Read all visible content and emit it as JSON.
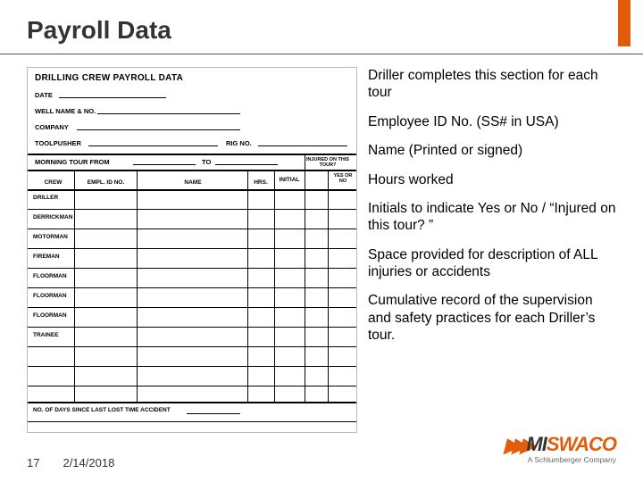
{
  "title": "Payroll Data",
  "form": {
    "header": "DRILLING CREW PAYROLL DATA",
    "fields": {
      "date": "DATE",
      "well": "WELL NAME & NO.",
      "company": "COMPANY",
      "toolpusher": "TOOLPUSHER",
      "rigno": "RIG NO.",
      "tourbar": "MORNING TOUR    FROM",
      "to": "TO"
    },
    "cols": {
      "crew": "CREW",
      "empl": "EMPL. ID NO.",
      "name": "NAME",
      "hrs": "HRS.",
      "initial": "INITIAL",
      "injured": "INJURED ON THIS TOUR?",
      "yesno": "YES OR NO"
    },
    "roles": [
      "DRILLER",
      "DERRICKMAN",
      "MOTORMAN",
      "FIREMAN",
      "FLOORMAN",
      "FLOORMAN",
      "FLOORMAN",
      "TRAINEE"
    ],
    "bottom": "NO. OF DAYS SINCE LAST LOST TIME ACCIDENT"
  },
  "notes": [
    "Driller completes this section for each tour",
    "Employee ID No. (SS# in USA)",
    "Name (Printed or signed)",
    "Hours worked",
    "Initials to indicate Yes or No / “Injured on this tour? ”",
    "Space provided for description of ALL injuries or accidents",
    "Cumulative record of the supervision and safety practices for each Driller’s tour."
  ],
  "footer": {
    "page": "17",
    "date": "2/14/2018"
  },
  "logo": {
    "chev": "▶▶▶",
    "mi": "MI",
    "swaco": "SWACO",
    "sub": "A Schlumberger Company"
  }
}
